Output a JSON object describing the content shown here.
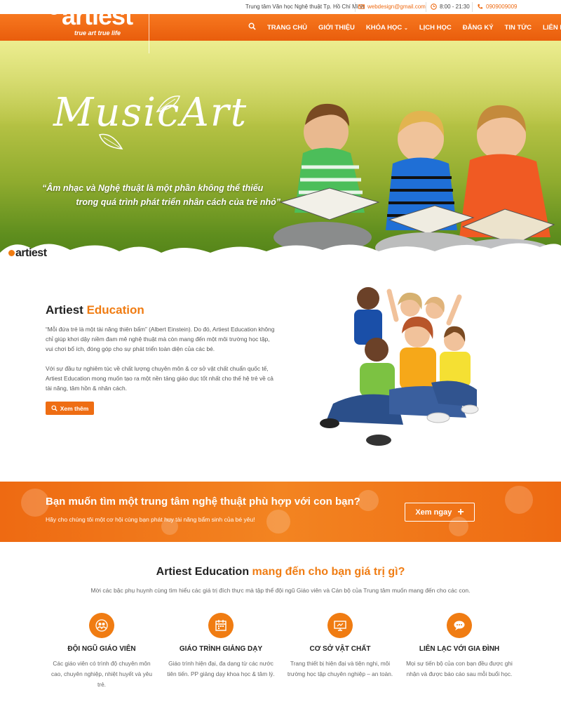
{
  "topbar": {
    "org": "Trung tâm Văn học Nghệ thuật Tp. Hồ Chí Minh",
    "email": "webdesign@gmail.com",
    "hours": "8:00 - 21:30",
    "phone": "0909009009"
  },
  "brand": {
    "name": "artiest",
    "tagline": "true art   true life"
  },
  "nav": {
    "items": [
      "TRANG CHỦ",
      "GIỚI THIỆU",
      "KHÓA HỌC",
      "LỊCH HỌC",
      "ĐĂNG KÝ",
      "TIN TỨC",
      "LIÊN HỆ"
    ]
  },
  "hero": {
    "script_title": "MusicArt",
    "quote_line1": "“Âm nhạc và Nghệ thuật là một phần không thể thiếu",
    "quote_line2": "trong quá trình phát triển nhân cách của trẻ nhỏ”",
    "brand_small": "artiest"
  },
  "about": {
    "title_plain": "Artiest ",
    "title_accent": "Education",
    "para1": "“Mỗi đứa trẻ là một tài năng thiên bẩm” (Albert Einstein). Do đó, Artiest Education không chỉ giúp khơi dậy niềm đam mê nghệ thuật mà còn mang đến một môi trường học tập, vui chơi bổ ích, đóng góp cho sự phát triển toàn diện của các bé.",
    "para2": "Với sự đầu tư nghiêm túc về chất lượng chuyên môn & cơ sở vật chất chuẩn quốc tế, Artiest Education mong muốn tạo ra một nền tảng giáo dục tốt nhất cho thế hệ trẻ về cả tài năng, tâm hồn & nhân cách.",
    "button": "Xem thêm"
  },
  "cta": {
    "title": "Bạn muốn tìm một trung tâm nghệ thuật phù hợp với con bạn?",
    "subtitle": "Hãy cho chúng tôi một cơ hội cùng bạn phát huy tài năng bẩm sinh của bé yêu!",
    "button": "Xem ngay"
  },
  "values": {
    "title_plain": "Artiest Education ",
    "title_accent": "mang đến cho bạn giá trị gì?",
    "subtitle": "Mời các bậc phụ huynh cùng tìm hiểu các giá trị đích thực mà tập thể đội ngũ Giáo viên và Cán bộ của Trung tâm muốn mang đến cho các con.",
    "features": [
      {
        "icon": "users-icon",
        "title": "ĐỘI NGŨ GIÁO VIÊN",
        "desc": "Các giáo viên có trình độ chuyên môn cao, chuyên nghiệp, nhiệt huyết và yêu trẻ."
      },
      {
        "icon": "calendar-icon",
        "title": "GIÁO TRÌNH GIẢNG DẠY",
        "desc": "Giáo trình hiện đại, đa dạng từ các nước tiên tiến. PP giảng dạy khoa học & tâm lý."
      },
      {
        "icon": "monitor-icon",
        "title": "CƠ SỞ VẬT CHẤT",
        "desc": "Trang thiết bị hiện đại và tiện nghi, môi trường học tập chuyên nghiệp – an toàn."
      },
      {
        "icon": "chat-icon",
        "title": "LIÊN LẠC VỚI GIA ĐÌNH",
        "desc": "Mọi sự tiến bộ của con bạn đều được ghi nhận và được báo cáo sau mỗi buổi học."
      }
    ]
  },
  "colors": {
    "accent": "#f07c12",
    "nav_bg": "#ee6a12"
  }
}
